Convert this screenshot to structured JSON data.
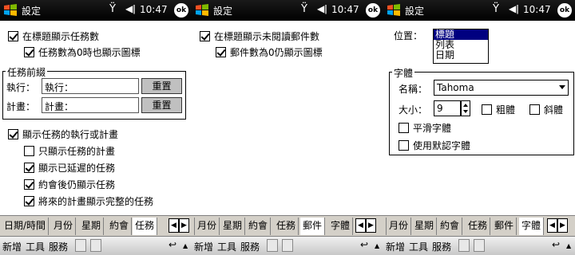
{
  "status": {
    "time": "10:47",
    "ok_label": "ok"
  },
  "screens": [
    {
      "title": "設定",
      "show_task_count": "在標題顯示任務數",
      "show_icon_zero": "任務數為0時也顯示圖標",
      "prefix_group": "任務前綴",
      "exec_label": "執行：",
      "exec_value": "執行：",
      "plan_label": "計畫：",
      "plan_value": "計畫：",
      "reset_label": "重置",
      "show_exec_plan": "顯示任務的執行或計畫",
      "only_plan": "只顯示任務的計畫",
      "show_delayed": "顯示已延遲的任務",
      "after_appt": "約會後仍顯示任務",
      "future_full": "將來的計畫顯示完整的任務",
      "tabs": [
        "日期/時間",
        "月份",
        "星期",
        "約會",
        "任務"
      ]
    },
    {
      "title": "設定",
      "show_unread": "在標題顯示未閱讀郵件數",
      "show_icon_zero": "郵件數為0仍顯示圖標",
      "tabs": [
        "月份",
        "星期",
        "約會",
        "任務",
        "郵件"
      ],
      "partial_tab": "字體"
    },
    {
      "title": "設定",
      "position_label": "位置：",
      "position_options": [
        "標題",
        "列表",
        "日期"
      ],
      "font_group": "字體",
      "name_label": "名稱：",
      "font_name": "Tahoma",
      "size_label": "大小：",
      "size_value": "9",
      "bold": "粗體",
      "italic": "斜體",
      "smooth": "平滑字體",
      "default_font": "使用默認字體",
      "tabs": [
        "月份",
        "星期",
        "約會",
        "任務",
        "郵件",
        "字體"
      ]
    }
  ],
  "menu": {
    "new": "新增",
    "tools": "工具",
    "services": "服務"
  },
  "icons": {
    "left_arrow": "◀",
    "right_arrow": "▶",
    "undo": "↩",
    "up_caret": "▲"
  }
}
